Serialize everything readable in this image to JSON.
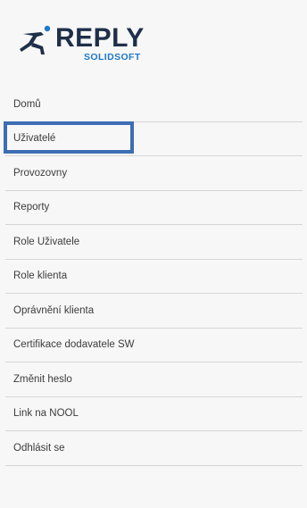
{
  "brand": {
    "name": "REPLY",
    "sub": "SOLIDSOFT",
    "logo_icon": "running-figure-icon",
    "colors": {
      "dark": "#1f2f4a",
      "accent": "#1f78c8",
      "highlight": "#3d6db4"
    }
  },
  "menu": {
    "items": [
      {
        "label": "Domů"
      },
      {
        "label": "Uživatelé",
        "highlighted": true
      },
      {
        "label": "Provozovny"
      },
      {
        "label": "Reporty"
      },
      {
        "label": "Role Uživatele"
      },
      {
        "label": "Role klienta"
      },
      {
        "label": "Oprávnění klienta"
      },
      {
        "label": "Certifikace dodavatele SW"
      },
      {
        "label": "Změnit heslo"
      },
      {
        "label": "Link na NOOL"
      },
      {
        "label": "Odhlásit se"
      }
    ]
  }
}
